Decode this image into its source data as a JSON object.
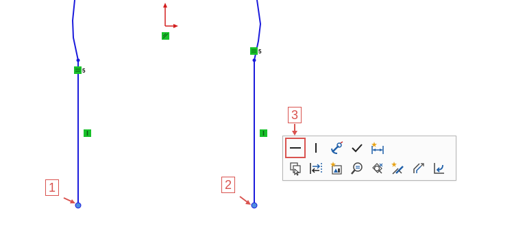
{
  "callouts": [
    {
      "label": "1"
    },
    {
      "label": "2"
    },
    {
      "label": "3"
    }
  ],
  "relations": {
    "tangent_suffix_left": "5",
    "tangent_suffix_right": "5"
  },
  "toolbar": {
    "row1": [
      "horizontal-relation-icon",
      "vertical-relation-icon",
      "fix-anchor-icon",
      "accept-check-icon",
      "smart-dimension-icon"
    ],
    "row2": [
      "copy-entities-icon",
      "convert-entities-icon",
      "add-relation-image-icon",
      "zoom-to-selection-icon",
      "display-delete-relations-icon",
      "sketch-fillet-icon",
      "offset-entities-icon",
      "exit-sketch-icon"
    ],
    "selected": "horizontal-relation-icon"
  },
  "colors": {
    "sketch_line": "#1a1adb",
    "relation_marker": "#18c02a",
    "callout": "#d9534f",
    "origin_x": "#d21e1e",
    "origin_y": "#d21e1e",
    "endpoint_fill": "#4e8ee0"
  }
}
